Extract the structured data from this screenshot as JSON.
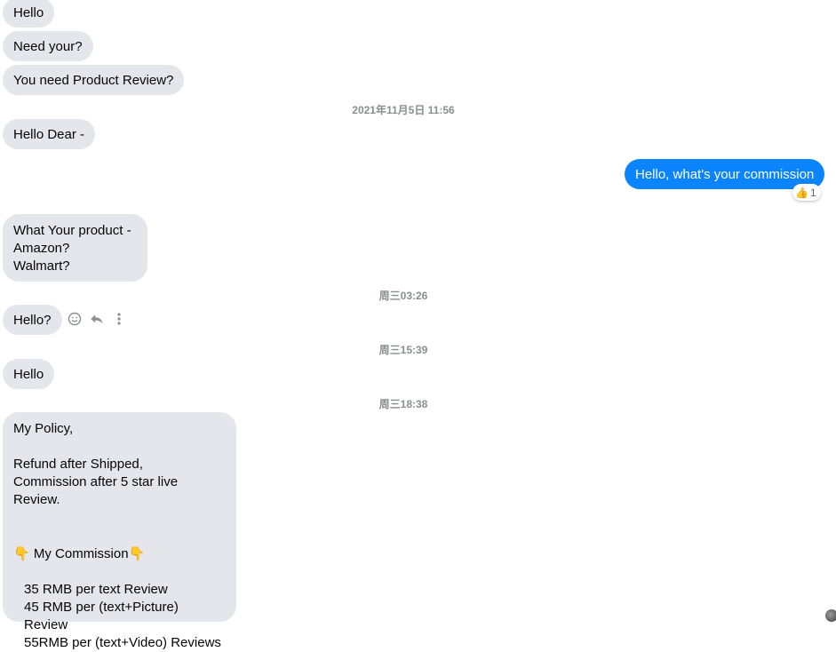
{
  "conversation": {
    "m1": "Hello",
    "m2": "Need your?",
    "m3": "You need Product Review?",
    "ts1": "2021年11月5日 11:56",
    "m4": "Hello Dear -",
    "m5": "Hello, what's your commission",
    "reaction": {
      "emoji": "👍",
      "count": "1"
    },
    "m6": "What Your product -\nAmazon?\nWalmart?",
    "ts2": "周三03:26",
    "m7": "Hello?",
    "ts3": "周三15:39",
    "m8": "Hello",
    "ts4": "周三18:38",
    "m9": {
      "line1": "My Policy,",
      "line2": "Refund after Shipped,",
      "line3": "Commission after 5 star live Review.",
      "pointer_emoji": "👇",
      "commission_title": " My Commission",
      "rate1": "35 RMB per text Review",
      "rate2": "45 RMB per (text+Picture) Review",
      "rate3": "55RMB per (text+Video) Reviews"
    }
  },
  "message_actions": {
    "icons": [
      "smiley-icon",
      "reply-icon",
      "more-vertical-icon"
    ]
  },
  "colors": {
    "incoming_bubble": "#e4e6eb",
    "outgoing_bubble": "#0a84ff",
    "timestamp": "#8a8d91"
  }
}
